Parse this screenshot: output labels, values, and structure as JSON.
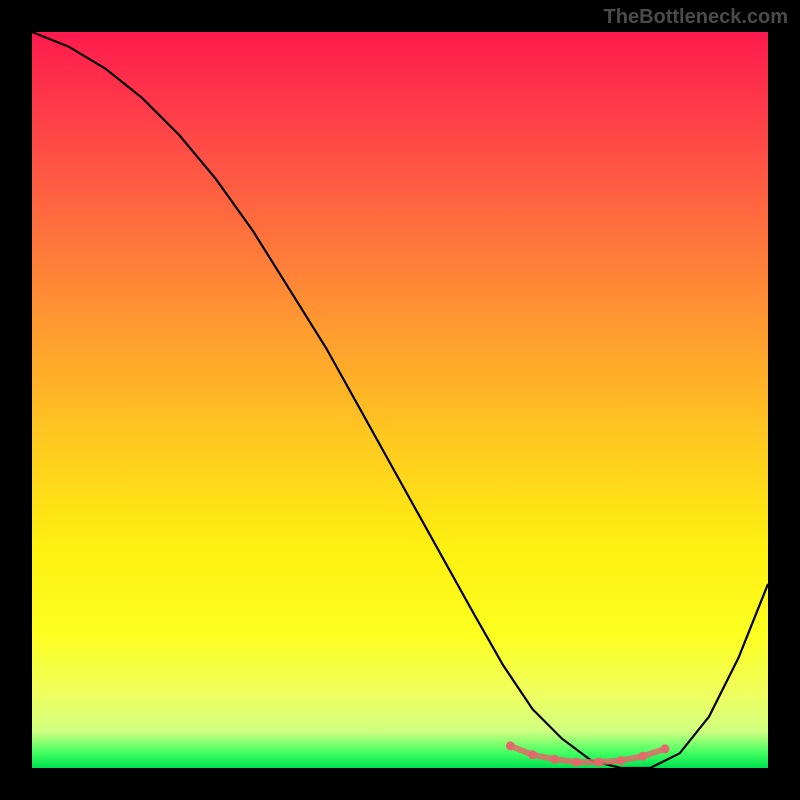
{
  "watermark": "TheBottleneck.com",
  "chart_data": {
    "type": "line",
    "title": "",
    "xlabel": "",
    "ylabel": "",
    "xlim": [
      0,
      100
    ],
    "ylim": [
      0,
      100
    ],
    "series": [
      {
        "name": "bottleneck-curve",
        "x": [
          0,
          5,
          10,
          15,
          20,
          25,
          30,
          35,
          40,
          45,
          50,
          55,
          60,
          64,
          68,
          72,
          76,
          80,
          84,
          88,
          92,
          96,
          100
        ],
        "values": [
          100,
          98,
          95,
          91,
          86,
          80,
          73,
          65,
          57,
          48,
          39,
          30,
          21,
          14,
          8,
          4,
          1,
          0,
          0,
          2,
          7,
          15,
          25
        ],
        "color": "#000000"
      },
      {
        "name": "optimal-range-markers",
        "x": [
          65,
          68,
          71,
          74,
          77,
          80,
          83,
          86
        ],
        "values": [
          3.0,
          1.8,
          1.2,
          0.8,
          0.8,
          1.0,
          1.6,
          2.6
        ],
        "color": "#e36a6a",
        "style": "dots"
      }
    ],
    "background_gradient": {
      "stops": [
        {
          "pos": 0.0,
          "color": "#ff1a4d"
        },
        {
          "pos": 0.25,
          "color": "#ff6a3f"
        },
        {
          "pos": 0.55,
          "color": "#ffc820"
        },
        {
          "pos": 0.82,
          "color": "#fcff20"
        },
        {
          "pos": 0.98,
          "color": "#40ff60"
        },
        {
          "pos": 1.0,
          "color": "#00e050"
        }
      ]
    }
  }
}
